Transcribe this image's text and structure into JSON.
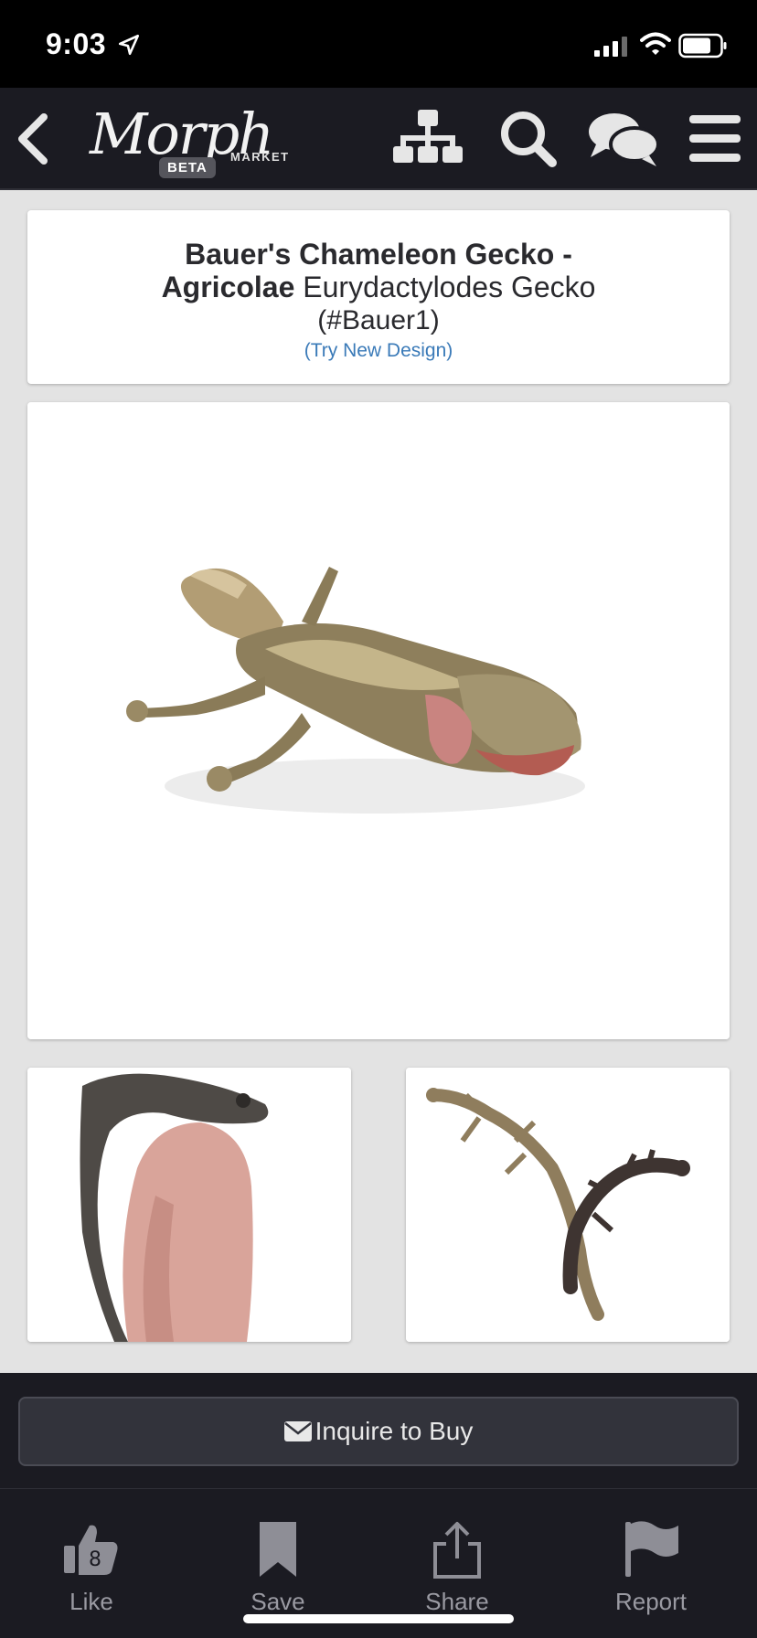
{
  "status_bar": {
    "time": "9:03",
    "icons": [
      "location-arrow-icon",
      "signal-icon",
      "wifi-icon",
      "battery-icon"
    ]
  },
  "nav": {
    "logo_text": "Morph",
    "logo_sub": "MARKET",
    "logo_badge": "BETA",
    "buttons": [
      "back-icon",
      "sitemap-icon",
      "search-icon",
      "chat-icon",
      "menu-icon"
    ]
  },
  "listing": {
    "title_bold": "Bauer's Chameleon Gecko -",
    "trait_bold": "Agricolae",
    "species": " Eurydactylodes Gecko",
    "id": "(#Bauer1)",
    "try_link": "(Try New Design)"
  },
  "actions": {
    "inquire_label": "Inquire to Buy"
  },
  "tabs": [
    {
      "label": "Like",
      "icon": "thumbs-up-icon",
      "count": "8"
    },
    {
      "label": "Save",
      "icon": "bookmark-icon"
    },
    {
      "label": "Share",
      "icon": "share-icon"
    },
    {
      "label": "Report",
      "icon": "flag-icon"
    }
  ],
  "colors": {
    "nav_bg": "#1b1b22",
    "page_bg": "#e3e3e3",
    "link": "#3a7ab8"
  }
}
